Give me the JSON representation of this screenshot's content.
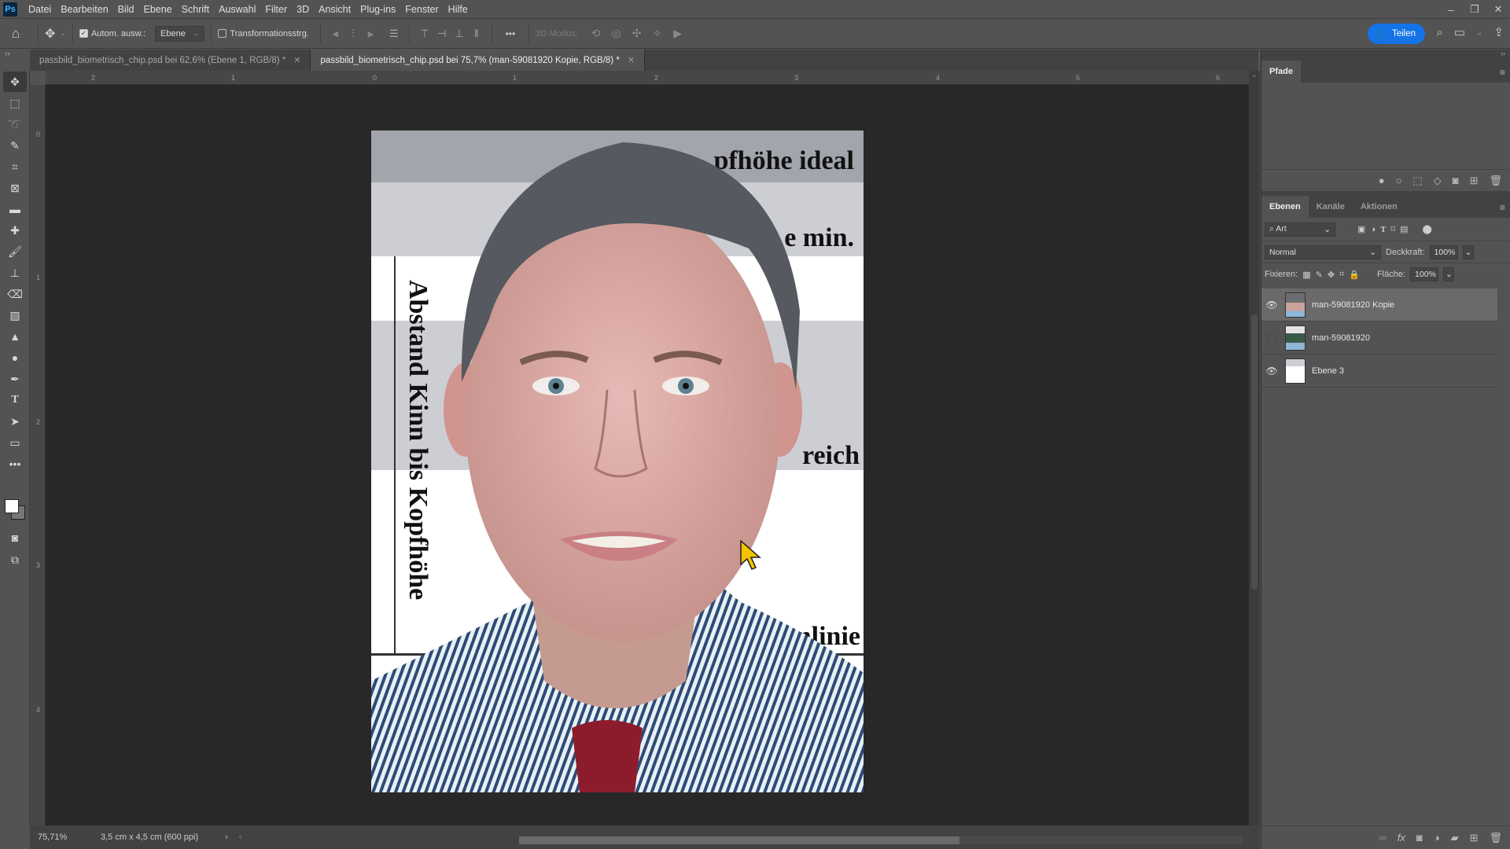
{
  "app": {
    "logo": "Ps"
  },
  "menu": [
    "Datei",
    "Bearbeiten",
    "Bild",
    "Ebene",
    "Schrift",
    "Auswahl",
    "Filter",
    "3D",
    "Ansicht",
    "Plug-ins",
    "Fenster",
    "Hilfe"
  ],
  "window_controls": {
    "minimize": "–",
    "restore": "❐",
    "close": "✕"
  },
  "options": {
    "auto_select_label": "Autom. ausw.:",
    "auto_select_checked": true,
    "auto_select_target": "Ebene",
    "transform_label": "Transformationsstrg.",
    "transform_checked": false,
    "more": "•••",
    "mode3d_label": "3D-Modus:",
    "share_label": "Teilen"
  },
  "tabs": [
    {
      "label": "passbild_biometrisch_chip.psd bei 62,6% (Ebene 1, RGB/8) *",
      "active": false
    },
    {
      "label": "passbild_biometrisch_chip.psd bei 75,7% (man-59081920 Kopie, RGB/8) *",
      "active": true
    }
  ],
  "ruler": {
    "h": [
      "2",
      "1",
      "0",
      "1",
      "2",
      "3",
      "4",
      "5",
      "6"
    ],
    "v": [
      "0",
      "1",
      "2",
      "3",
      "4"
    ]
  },
  "document": {
    "labels": {
      "top1": "pfhöhe ideal",
      "top2": "e min.",
      "mid": "reich",
      "bottom": "Kinnlinie",
      "vertical": "Abstand Kinn bis Kopfhöhe"
    },
    "colors": {
      "band_dark": "#a3a5ad",
      "band_light": "#cdced3",
      "white": "#ffffff",
      "hair": "#55585e",
      "skin": "#d9a9a8",
      "shirt": "#2d4a78",
      "tie": "#8c1c2c"
    }
  },
  "status": {
    "zoom": "75,71%",
    "doc_info": "3,5 cm x 4,5 cm (600 ppi)"
  },
  "paths_panel": {
    "tab": "Pfade"
  },
  "layers_panel": {
    "tabs": [
      "Ebenen",
      "Kanäle",
      "Aktionen"
    ],
    "filter_label": "Art",
    "blend_mode": "Normal",
    "opacity_label": "Deckkraft:",
    "opacity_value": "100%",
    "lock_label": "Fixieren:",
    "fill_label": "Fläche:",
    "fill_value": "100%",
    "layers": [
      {
        "name": "man-59081920 Kopie",
        "visible": true,
        "selected": true
      },
      {
        "name": "man-59081920",
        "visible": false,
        "selected": false
      },
      {
        "name": "Ebene 3",
        "visible": true,
        "selected": false
      }
    ]
  }
}
